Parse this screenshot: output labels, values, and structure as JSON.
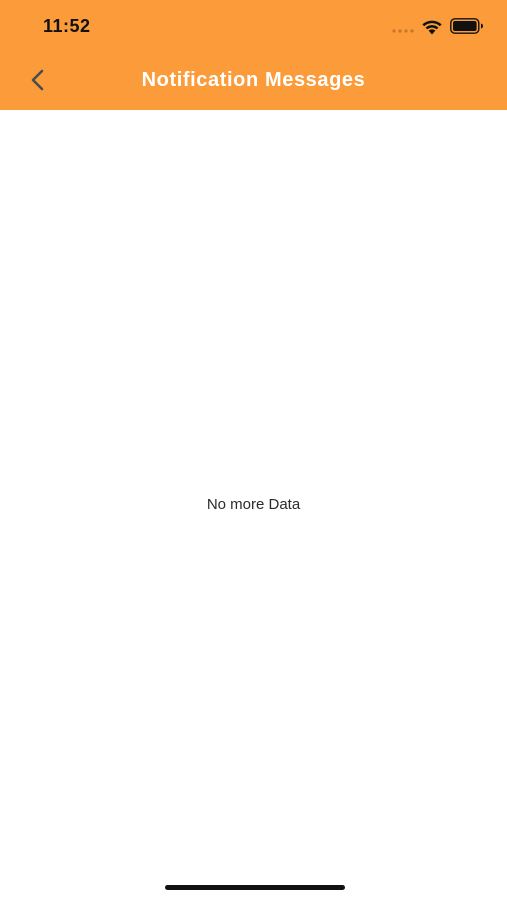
{
  "status_bar": {
    "time": "11:52"
  },
  "header": {
    "title": "Notification Messages",
    "background_color": "#FB9B3A",
    "back_icon": "chevron-left-icon"
  },
  "main": {
    "empty_message": "No more Data"
  },
  "icons": {
    "signal": "signal-icon",
    "wifi": "wifi-icon",
    "battery": "battery-icon"
  }
}
